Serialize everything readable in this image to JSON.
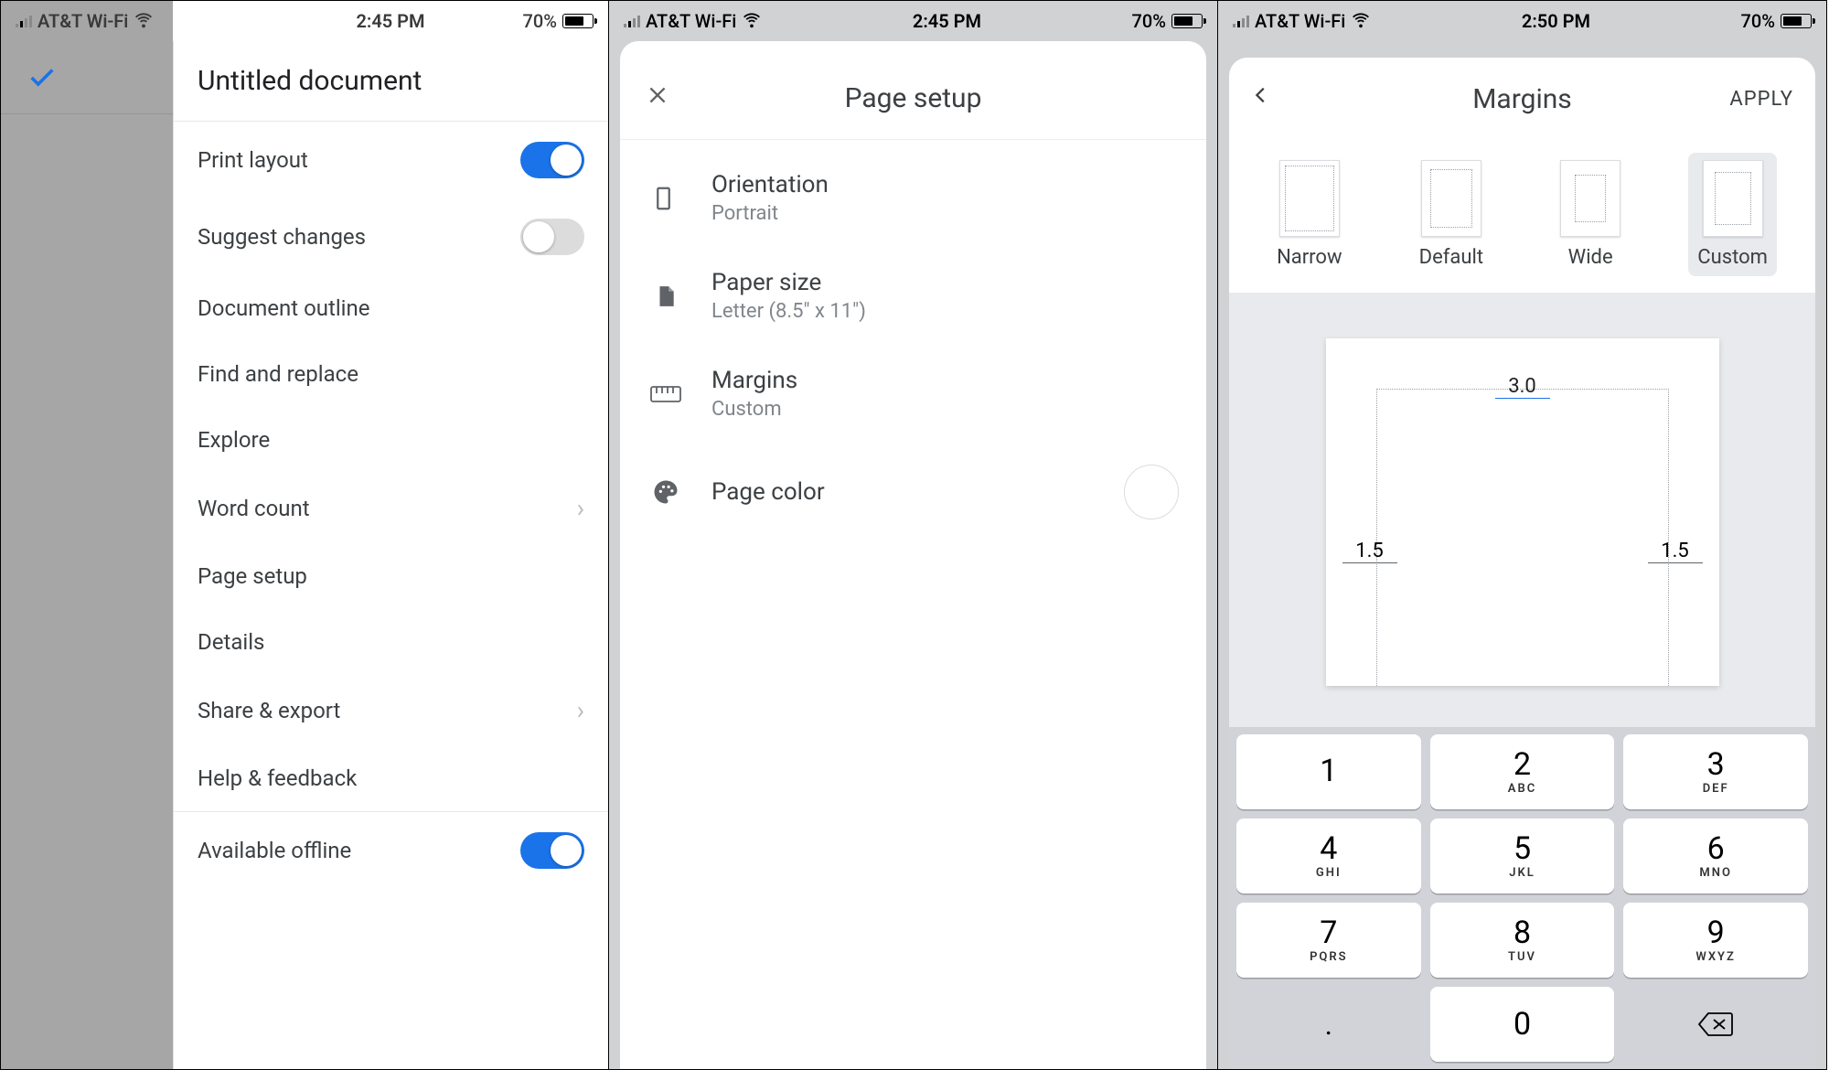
{
  "status": {
    "carrier": "AT&T Wi-Fi",
    "time1": "2:45 PM",
    "time2": "2:45 PM",
    "time3": "2:50 PM",
    "battery_pct": "70%",
    "battery_fill_pct": 70
  },
  "screen1": {
    "title": "Untitled document",
    "items": {
      "print_layout": "Print layout",
      "suggest_changes": "Suggest changes",
      "document_outline": "Document outline",
      "find_replace": "Find and replace",
      "explore": "Explore",
      "word_count": "Word count",
      "page_setup": "Page setup",
      "details": "Details",
      "share_export": "Share & export",
      "help_feedback": "Help & feedback",
      "available_offline": "Available offline"
    },
    "toggles": {
      "print_layout": true,
      "suggest_changes": false,
      "available_offline": true
    }
  },
  "screen2": {
    "title": "Page setup",
    "orientation": {
      "label": "Orientation",
      "value": "Portrait"
    },
    "paper_size": {
      "label": "Paper size",
      "value": "Letter (8.5\" x 11\")"
    },
    "margins": {
      "label": "Margins",
      "value": "Custom"
    },
    "page_color": {
      "label": "Page color"
    }
  },
  "screen3": {
    "title": "Margins",
    "apply": "APPLY",
    "presets": {
      "narrow": "Narrow",
      "default": "Default",
      "wide": "Wide",
      "custom": "Custom"
    },
    "values": {
      "top": "3.0",
      "left": "1.5",
      "right": "1.5"
    }
  },
  "keypad": {
    "k1": {
      "n": "1",
      "s": ""
    },
    "k2": {
      "n": "2",
      "s": "ABC"
    },
    "k3": {
      "n": "3",
      "s": "DEF"
    },
    "k4": {
      "n": "4",
      "s": "GHI"
    },
    "k5": {
      "n": "5",
      "s": "JKL"
    },
    "k6": {
      "n": "6",
      "s": "MNO"
    },
    "k7": {
      "n": "7",
      "s": "PQRS"
    },
    "k8": {
      "n": "8",
      "s": "TUV"
    },
    "k9": {
      "n": "9",
      "s": "WXYZ"
    },
    "dot": ".",
    "k0": "0"
  }
}
